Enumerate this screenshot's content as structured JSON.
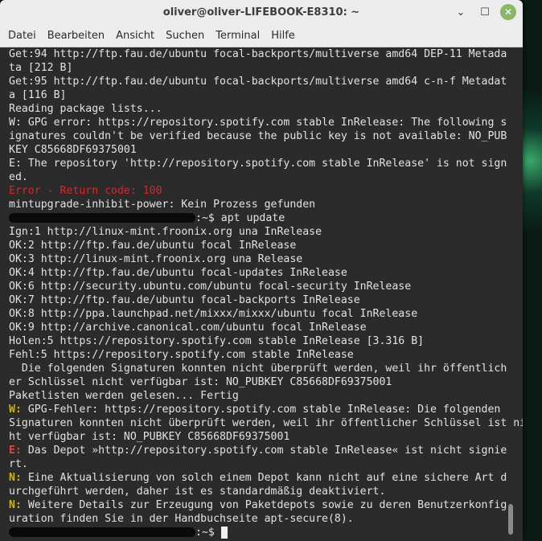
{
  "window": {
    "title": "oliver@oliver-LIFEBOOK-E8310: ~",
    "minimize_glyph": "⌄",
    "maximize_glyph": "☐",
    "close_glyph": "✕"
  },
  "menu": [
    "Datei",
    "Bearbeiten",
    "Ansicht",
    "Suchen",
    "Terminal",
    "Hilfe"
  ],
  "colors": {
    "error_red": "#d72828",
    "warn_yellow": "#d6b400",
    "terminal_bg": "#2b2b2b",
    "terminal_fg": "#e2e2e2"
  },
  "terminal": {
    "l01": "Get:94 http://ftp.fau.de/ubuntu focal-backports/multiverse amd64 DEP-11 Metada",
    "l02": "ta [212 B]",
    "l03": "Get:95 http://ftp.fau.de/ubuntu focal-backports/multiverse amd64 c-n-f Metadat",
    "l04": "a [116 B]",
    "l05": "Reading package lists...",
    "l06": "W: GPG error: https://repository.spotify.com stable InRelease: The following s",
    "l07": "ignatures couldn't be verified because the public key is not available: NO_PUB",
    "l08": "KEY C85668DF69375001",
    "l09": "E: The repository 'http://repository.spotify.com stable InRelease' is not sign",
    "l10": "ed.",
    "l11": "Error - Return code: 100",
    "l12": "mintupgrade-inhibit-power: Kein Prozess gefunden",
    "l13_prompt": ":~$ apt update",
    "l14": "Ign:1 http://linux-mint.froonix.org una InRelease",
    "l15": "OK:2 http://ftp.fau.de/ubuntu focal InRelease",
    "l16": "OK:3 http://linux-mint.froonix.org una Release",
    "l17": "OK:4 http://ftp.fau.de/ubuntu focal-updates InRelease",
    "l18": "OK:6 http://security.ubuntu.com/ubuntu focal-security InRelease",
    "l19": "OK:7 http://ftp.fau.de/ubuntu focal-backports InRelease",
    "l20": "OK:8 http://ppa.launchpad.net/mixxx/mixxx/ubuntu focal InRelease",
    "l21": "OK:9 http://archive.canonical.com/ubuntu focal InRelease",
    "l22": "Holen:5 https://repository.spotify.com stable InRelease [3.316 B]",
    "l23": "Fehl:5 https://repository.spotify.com stable InRelease",
    "l24": "  Die folgenden Signaturen konnten nicht überprüft werden, weil ihr öffentlich",
    "l25": "er Schlüssel nicht verfügbar ist: NO_PUBKEY C85668DF69375001",
    "l26": "Paketlisten werden gelesen... Fertig",
    "l27_tag": "W:",
    "l27": " GPG-Fehler: https://repository.spotify.com stable InRelease: Die folgenden",
    "l28": "Signaturen konnten nicht überprüft werden, weil ihr öffentlicher Schlüssel ist nic",
    "l28b": "ht verfügbar ist: NO_PUBKEY C85668DF69375001",
    "l29_tag": "E:",
    "l29": " Das Depot »http://repository.spotify.com stable InRelease« ist nicht signie",
    "l30": "rt.",
    "l31_tag": "N:",
    "l31": " Eine Aktualisierung von solch einem Depot kann nicht auf eine sichere Art d",
    "l32": "urchgeführt werden, daher ist es standardmäßig deaktiviert.",
    "l33_tag": "N:",
    "l33": " Weitere Details zur Erzeugung von Paketdepots sowie zu deren Benutzerkonfig",
    "l34": "uration finden Sie in der Handbuchseite apt-secure(8).",
    "l35_prompt": ":~$ "
  }
}
